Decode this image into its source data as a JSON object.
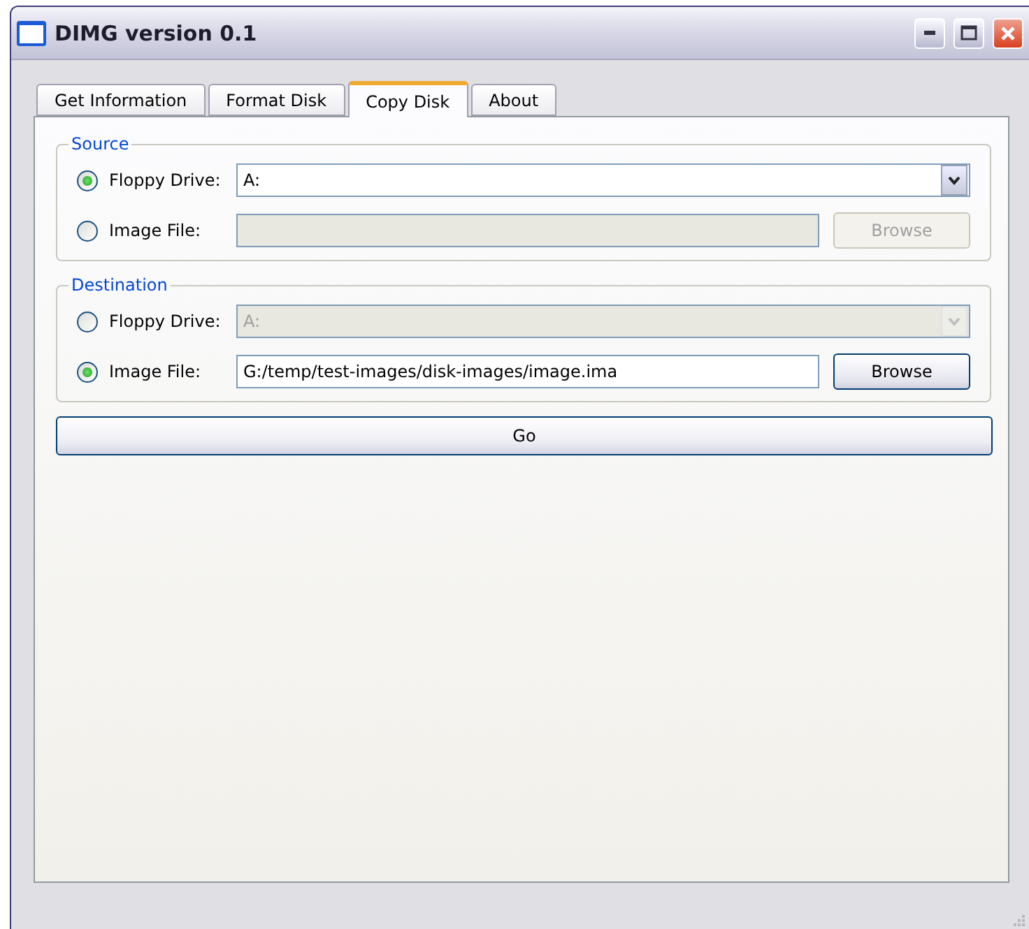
{
  "window": {
    "title": "DIMG version 0.1"
  },
  "tabs": [
    {
      "label": "Get Information",
      "selected": false
    },
    {
      "label": "Format Disk",
      "selected": false
    },
    {
      "label": "Copy Disk",
      "selected": true
    },
    {
      "label": "About",
      "selected": false
    }
  ],
  "groups": [
    {
      "legend": "Source",
      "rows": [
        {
          "kind": "dropdown",
          "label": "Floppy Drive:",
          "selected": true,
          "value": "A:",
          "disabled": false
        },
        {
          "kind": "file",
          "label": "Image File:",
          "selected": false,
          "disabled": true,
          "button": "Browse"
        }
      ]
    },
    {
      "legend": "Destination",
      "rows": [
        {
          "kind": "dropdown",
          "label": "Floppy Drive:",
          "selected": false,
          "value": "A:",
          "disabled": true
        },
        {
          "kind": "file",
          "label": "Image File:",
          "selected": true,
          "value": "G:/temp/test-images/disk-images/image.ima",
          "disabled": false,
          "button": "Browse"
        }
      ]
    }
  ],
  "go_button": "Go"
}
